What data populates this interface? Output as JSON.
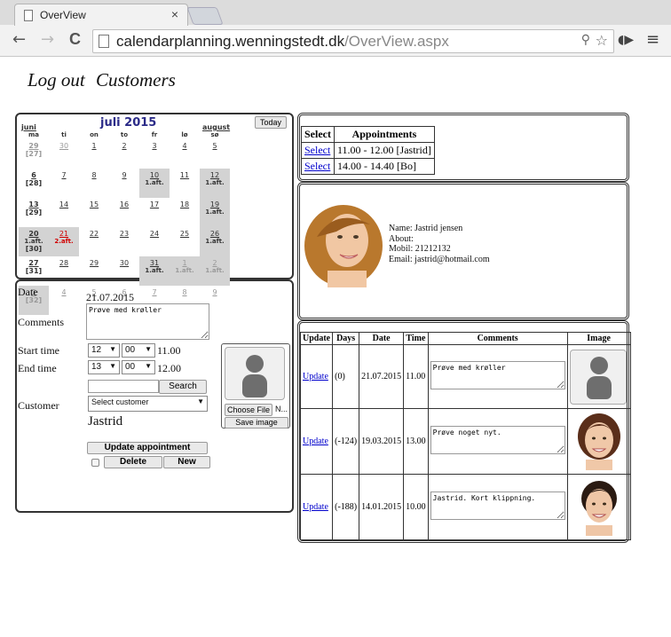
{
  "browser": {
    "tab_title": "OverView",
    "tab_close": "×",
    "url_host": "calendarplanning.wenningstedt.dk",
    "url_path": "/OverView.aspx",
    "back": "←",
    "forward": "→",
    "reload": "C",
    "zoom_glyph": "⚲",
    "star_glyph": "☆",
    "ext_glyph": "◖▶",
    "menu_glyph": "≡"
  },
  "nav": {
    "logout": "Log out",
    "customers": "Customers"
  },
  "calendar": {
    "prev": "juni",
    "title": "juli 2015",
    "next": "august",
    "today": "Today",
    "headers": [
      "ma",
      "ti",
      "on",
      "to",
      "fr",
      "lø",
      "sø"
    ],
    "rows": [
      {
        "week": "[27]",
        "weekday": "29",
        "cells": [
          "30",
          "1",
          "2",
          "3",
          "4",
          "5"
        ]
      },
      {
        "week": "[28]",
        "weekday": "6",
        "cells": [
          "7",
          "8",
          "9",
          "10",
          "11",
          "12"
        ]
      },
      {
        "week": "[29]",
        "weekday": "13",
        "cells": [
          "14",
          "15",
          "16",
          "17",
          "18",
          "19"
        ]
      },
      {
        "week": "[30]",
        "weekday": "20",
        "cells": [
          "21",
          "22",
          "23",
          "24",
          "25",
          "26"
        ]
      },
      {
        "week": "[31]",
        "weekday": "27",
        "cells": [
          "28",
          "29",
          "30",
          "31",
          "1",
          "2"
        ]
      },
      {
        "week": "[32]",
        "weekday": "3",
        "cells": [
          "4",
          "5",
          "6",
          "7",
          "8",
          "9"
        ]
      }
    ],
    "tag": "1.aft.",
    "tag_red": "2.aft."
  },
  "form": {
    "date_label": "Date",
    "date_value": "21.07.2015",
    "comments_label": "Comments",
    "comments_value": "Prøve med krøller",
    "start_label": "Start time",
    "start_hour": "12",
    "start_min": "00",
    "start_value": "11.00",
    "end_label": "End time",
    "end_hour": "13",
    "end_min": "00",
    "end_value": "12.00",
    "search_button": "Search",
    "customer_label": "Customer",
    "customer_select": "Select customer",
    "customer_name": "Jastrid",
    "choose_file": "Choose File",
    "no_file": "N...",
    "save_image": "Save image",
    "update_button": "Update appointment",
    "delete_button": "Delete",
    "new_button": "New"
  },
  "appointments": {
    "headers": [
      "Select",
      "Appointments"
    ],
    "rows": [
      {
        "select": "Select",
        "text": "11.00 - 12.00 [Jastrid]"
      },
      {
        "select": "Select",
        "text": "14.00 - 14.40 [Bo]"
      }
    ]
  },
  "customer": {
    "name": "Name: Jastrid  jensen",
    "about": "About:",
    "mobil": "Mobil: 21212132",
    "email": "Email: jastrid@hotmail.com"
  },
  "history": {
    "headers": [
      "Update",
      "Days",
      "Date",
      "Time",
      "Comments",
      "Image"
    ],
    "rows": [
      {
        "update": "Update",
        "days": "(0)",
        "date": "21.07.2015",
        "time": "11.00",
        "comment": "Prøve med krøller"
      },
      {
        "update": "Update",
        "days": "(-124)",
        "date": "19.03.2015",
        "time": "13.00",
        "comment": "Prøve noget nyt."
      },
      {
        "update": "Update",
        "days": "(-188)",
        "date": "14.01.2015",
        "time": "10.00",
        "comment": "Jastrid. Kort klippning."
      }
    ]
  },
  "colors": {
    "link": "#0000cc",
    "calendar_title": "#2b2b88",
    "shade": "#d3d3d3",
    "red_day": "#d10000"
  }
}
